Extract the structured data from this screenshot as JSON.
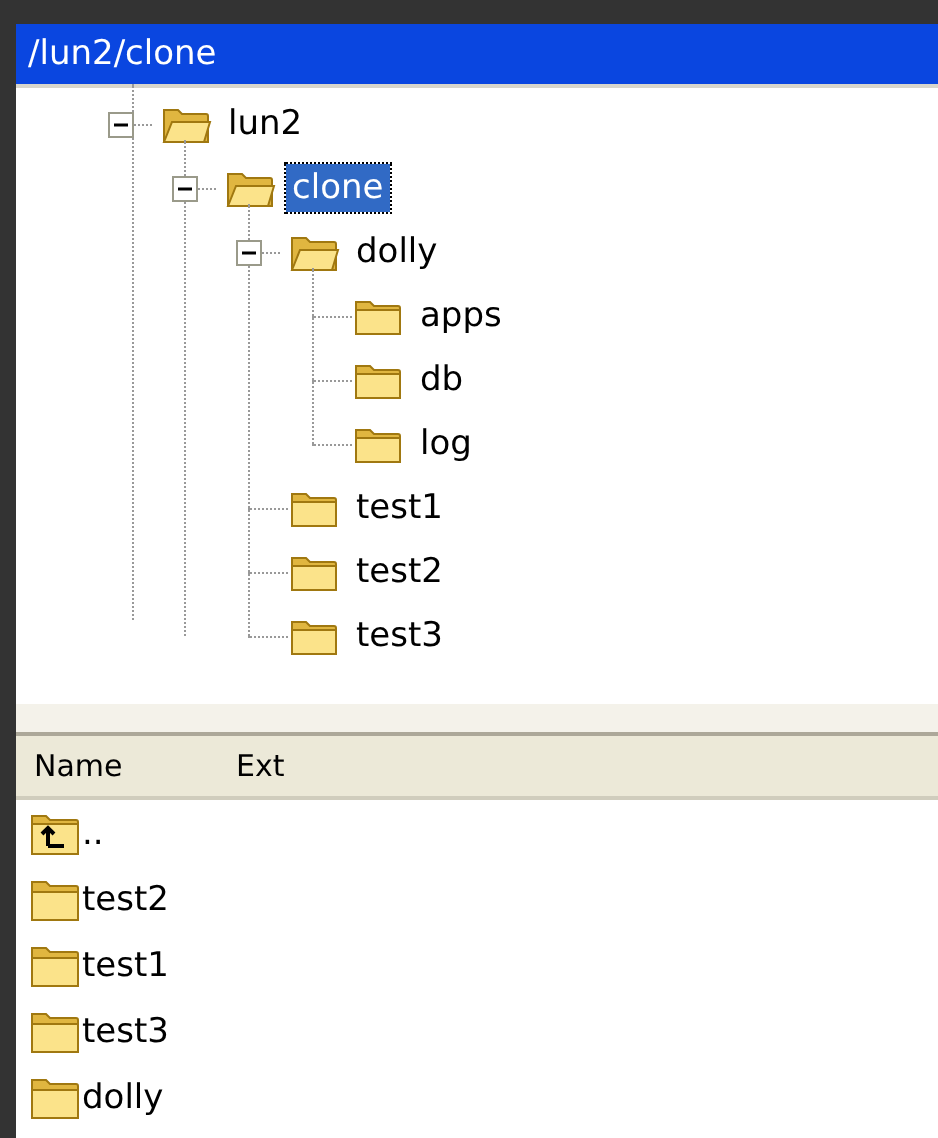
{
  "title_bar": {
    "title": "/lun2/clone"
  },
  "tree": [
    {
      "label": "lun2",
      "expanded": true,
      "selected": false,
      "children": [
        {
          "label": "clone",
          "expanded": true,
          "selected": true,
          "children": [
            {
              "label": "dolly",
              "expanded": true,
              "selected": false,
              "children": [
                {
                  "label": "apps",
                  "selected": false
                },
                {
                  "label": "db",
                  "selected": false
                },
                {
                  "label": "log",
                  "selected": false
                }
              ]
            },
            {
              "label": "test1",
              "selected": false
            },
            {
              "label": "test2",
              "selected": false
            },
            {
              "label": "test3",
              "selected": false
            }
          ]
        }
      ]
    }
  ],
  "file_list": {
    "columns": [
      "Name",
      "Ext"
    ],
    "rows": [
      {
        "kind": "parent",
        "name": ".."
      },
      {
        "kind": "folder",
        "name": "test2"
      },
      {
        "kind": "folder",
        "name": "test1"
      },
      {
        "kind": "folder",
        "name": "test3"
      },
      {
        "kind": "folder",
        "name": "dolly"
      }
    ]
  }
}
